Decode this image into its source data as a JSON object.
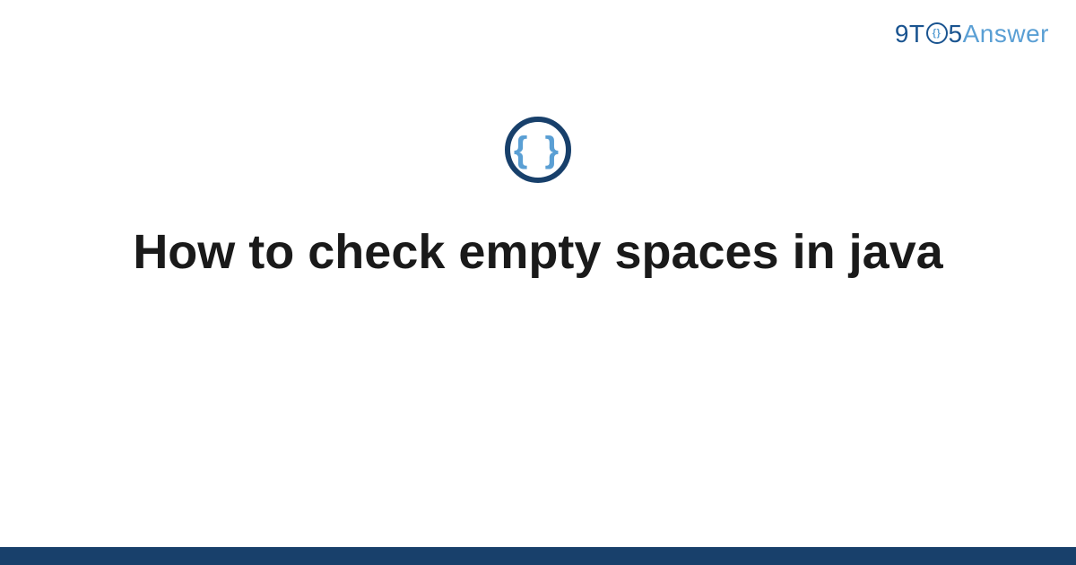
{
  "brand": {
    "part1": "9T",
    "o_inner": "{}",
    "part2": "5",
    "part3": "Answer"
  },
  "category_icon": {
    "name": "code-braces-icon",
    "glyph": "{ }"
  },
  "title": "How to check empty spaces in java",
  "colors": {
    "dark_blue": "#18406b",
    "mid_blue": "#1a5490",
    "light_blue": "#5a9fd4"
  }
}
